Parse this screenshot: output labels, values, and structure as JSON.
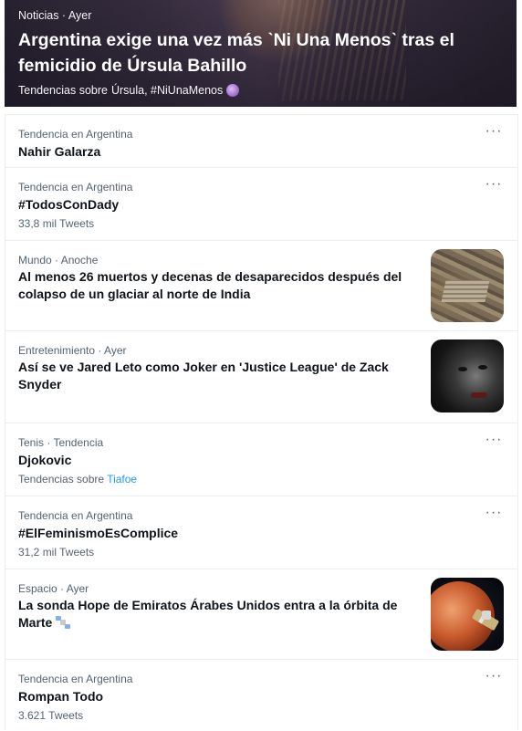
{
  "hero": {
    "meta": "Noticias · Ayer",
    "title": "Argentina exige una vez más ˋNi Una Menosˋ tras el femicidio de Úrsula Bahillo",
    "tags_prefix": "Tendencias sobre",
    "tags": "Úrsula, #NiUnaMenos"
  },
  "trends": [
    {
      "category": "Tendencia en Argentina",
      "name": "Nahir Galarza"
    },
    {
      "category": "Tendencia en Argentina",
      "name": "#TodosConDady",
      "count": "33,8 mil Tweets"
    },
    {
      "category": "Mundo · Anoche",
      "title": "Al menos 26 muertos y decenas de desaparecidos después del colapso de un glaciar al norte de India"
    },
    {
      "category": "Entretenimiento · Ayer",
      "title": "Así se ve Jared Leto como Joker en 'Justice League' de Zack Snyder"
    },
    {
      "category": "Tenis · Tendencia",
      "name": "Djokovic",
      "sub_prefix": "Tendencias sobre",
      "sub_link": "Tiafoe"
    },
    {
      "category": "Tendencia en Argentina",
      "name": "#ElFeminismoEsComplice",
      "count": "31,2 mil Tweets"
    },
    {
      "category": "Espacio · Ayer",
      "title": "La sonda Hope de Emiratos Árabes Unidos entra a la órbita de Marte"
    },
    {
      "category": "Tendencia en Argentina",
      "name": "Rompan Todo",
      "count": "3.621 Tweets"
    }
  ],
  "more_glyph": "···",
  "icons": {
    "hero_tag_emoji": "crystal-ball-icon",
    "more": "more-options-icon",
    "space_emoji": "satellite-icon"
  },
  "colors": {
    "link": "#1d9bf0",
    "secondary_text": "#536471",
    "divider": "#eceff1"
  }
}
